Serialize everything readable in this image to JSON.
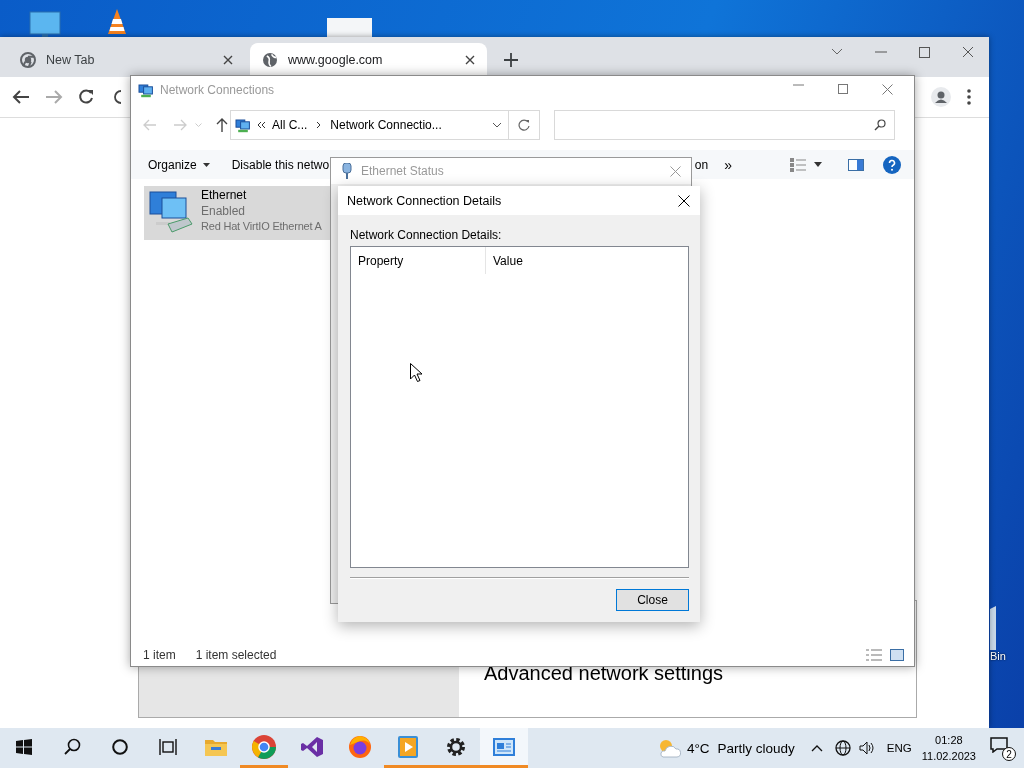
{
  "desktop_icons": [
    {
      "kind": "monitor"
    },
    {
      "kind": "cone"
    },
    {
      "kind": "document"
    },
    {
      "kind": "bin",
      "label": "Bin"
    }
  ],
  "browser": {
    "tabs": [
      {
        "label": "New Tab",
        "kind": "chrome",
        "selected": false
      },
      {
        "label": "www.google.com",
        "kind": "globe",
        "selected": true
      }
    ]
  },
  "settings_window": {
    "heading": "Advanced network settings"
  },
  "explorer": {
    "title": "Network Connections",
    "address": [
      "All C...",
      "Network Connectio..."
    ],
    "commands": [
      {
        "label": "Organize",
        "kind": "menu"
      },
      {
        "label": "Disable this netwo",
        "kind": "plain"
      },
      {
        "label": "on",
        "kind": "plain"
      },
      {
        "label": "»",
        "kind": "overflow"
      }
    ],
    "items": [
      {
        "name": "Ethernet",
        "status": "Enabled",
        "device": "Red Hat VirtIO Ethernet A",
        "selected": true
      }
    ],
    "status_bar": [
      "1 item",
      "1 item selected"
    ]
  },
  "status_dialog": {
    "title": "Ethernet Status"
  },
  "details_dialog": {
    "title": "Network Connection Details",
    "label": "Network Connection Details:",
    "columns": [
      "Property",
      "Value"
    ],
    "buttons": [
      "Close"
    ]
  },
  "taskbar": {
    "apps": [
      {
        "kind": "folder",
        "running": false,
        "selected": false
      },
      {
        "kind": "chrome",
        "running": true,
        "selected": false
      },
      {
        "kind": "studio",
        "running": false,
        "selected": false
      },
      {
        "kind": "firefox",
        "running": false,
        "selected": false
      },
      {
        "kind": "player",
        "running": true,
        "selected": false
      },
      {
        "kind": "gear",
        "running": true,
        "selected": false
      },
      {
        "kind": "netwin",
        "running": true,
        "selected": true
      }
    ],
    "weather": {
      "temperature": "4°C",
      "condition": "Partly cloudy"
    },
    "language": "ENG",
    "time": "01:28",
    "date": "11.02.2023",
    "notifications": "2"
  }
}
